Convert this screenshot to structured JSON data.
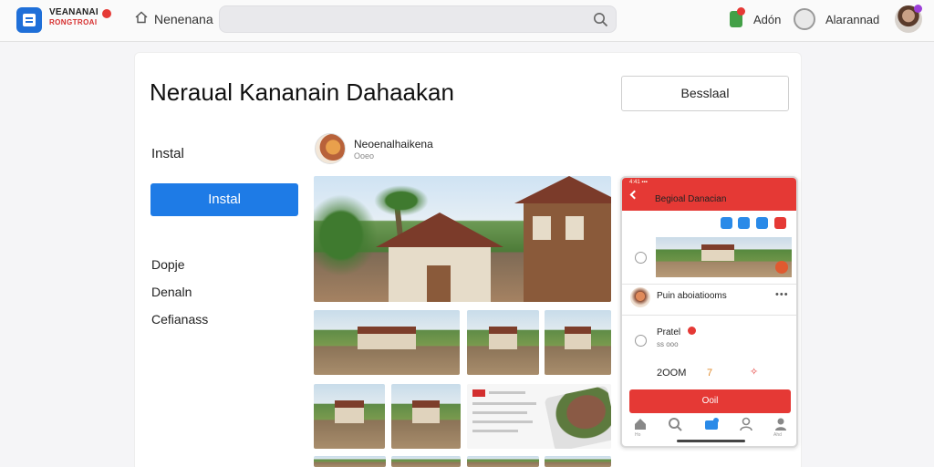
{
  "topbar": {
    "brand_top": "VEANANAI",
    "brand_bottom": "RONGTROAI",
    "home_label": "Nenenana",
    "search_placeholder": "",
    "add_label": "Adón",
    "user_name": "Alarannad"
  },
  "page": {
    "title": "Neraual Kananain Dahaakan",
    "top_button": "Besslaal",
    "install_text": "Instal",
    "install_button": "Instal",
    "links": [
      "Dopje",
      "Denaln",
      "Cefianass"
    ]
  },
  "publisher": {
    "name": "Neoenalhaikena",
    "meta": "Ooeo"
  },
  "phone": {
    "status": "4:41 ▪▪▪",
    "title": "Begioal Danacian",
    "post_name": "Puin aboiatiooms",
    "more": "•••",
    "price_label": "Pratel",
    "price_sub": "ss ooo",
    "count": "2OOM",
    "icon1": "7",
    "icon2": "✧",
    "cta": "Ooil",
    "nav_labels": [
      "Ho",
      "",
      "",
      "",
      "Ahd"
    ]
  },
  "colors": {
    "accent_blue": "#1e7be6",
    "accent_red": "#e53935",
    "brand_red": "#d62d2d"
  },
  "icons": {
    "logo": "app-logo-icon",
    "home": "home-icon",
    "search": "search-icon",
    "add": "add-icon",
    "user": "user-circle-icon"
  }
}
